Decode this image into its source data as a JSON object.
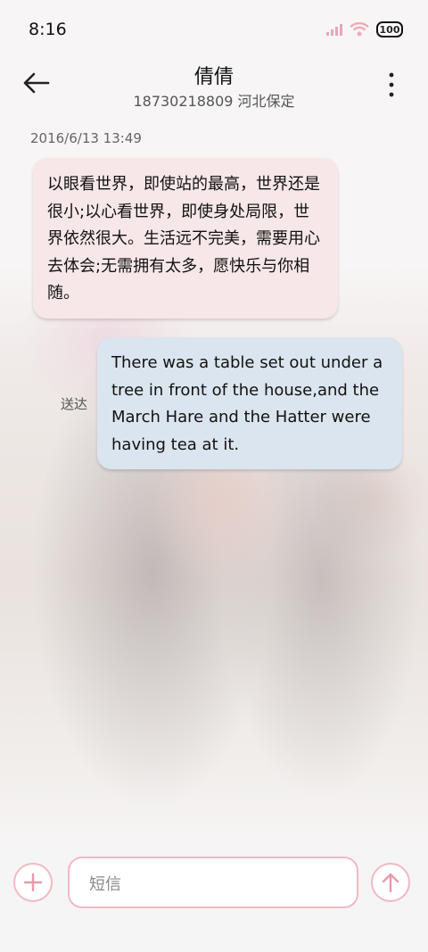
{
  "status_bar": {
    "time": "8:16",
    "battery": "100"
  },
  "header": {
    "title": "倩倩",
    "subtitle": "18730218809 河北保定"
  },
  "conversation": {
    "timestamp": "2016/6/13 13:49",
    "incoming_message": "以眼看世界，即使站的最高，世界还是很小;以心看世界，即使身处局限，世界依然很大。生活远不完美，需要用心去体会;无需拥有太多，愿快乐与你相随。",
    "outgoing_message": "There was a table set out under a tree in front of the house,and the March Hare and the Hatter were having tea at it.",
    "outgoing_status": "送达"
  },
  "composer": {
    "placeholder": "短信"
  },
  "colors": {
    "accent_pink": "#f0b9c4",
    "incoming_bubble": "#f7e7e9",
    "outgoing_bubble": "#dbe5ef"
  },
  "icons": [
    "signal-icon",
    "wifi-icon",
    "battery-icon",
    "back-arrow-icon",
    "more-vert-icon",
    "add-icon",
    "send-arrow-icon"
  ]
}
